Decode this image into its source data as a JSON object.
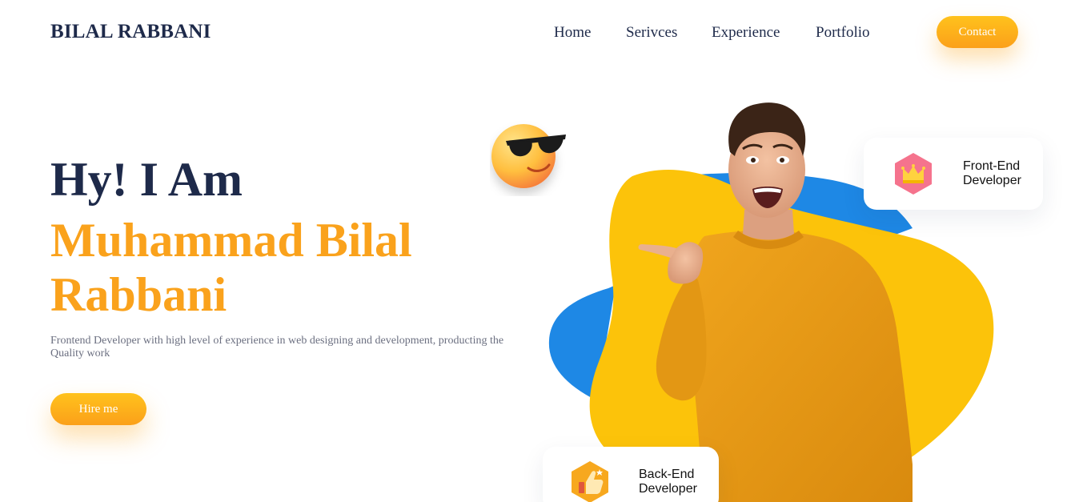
{
  "header": {
    "brand": "BILAL RABBANI",
    "nav": [
      {
        "label": "Home"
      },
      {
        "label": "Serivces"
      },
      {
        "label": "Experience"
      },
      {
        "label": "Portfolio"
      }
    ],
    "contact_label": "Contact"
  },
  "hero": {
    "greeting": "Hy! I Am",
    "name": "Muhammad Bilal Rabbani",
    "description": "Frontend Developer with high level of experience in web designing and development, producting the Quality work",
    "hire_label": "Hire me"
  },
  "cards": {
    "front_end": {
      "line1": "Front-End",
      "line2": "Developer",
      "icon": "crown-icon"
    },
    "back_end": {
      "line1": "Back-End",
      "line2": "Developer",
      "icon": "thumbs-up-icon"
    }
  },
  "colors": {
    "navy": "#1e2a4a",
    "accent_orange": "#faa21c",
    "blob_yellow": "#fcc30a",
    "blob_blue": "#1e88e5",
    "sweater": "#e89a15"
  }
}
